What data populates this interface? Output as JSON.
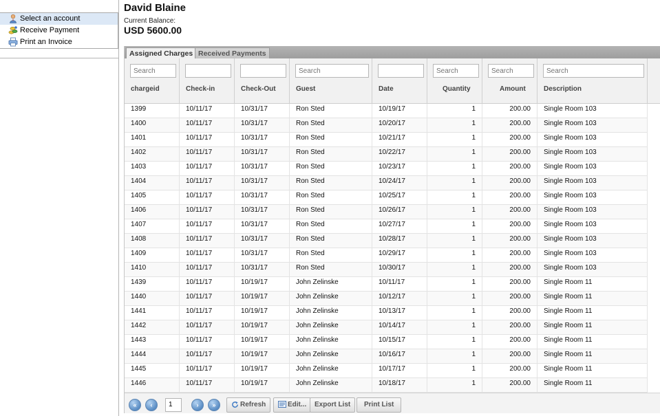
{
  "menu": {
    "items": [
      {
        "label": "Select an account",
        "icon": "person-icon",
        "selected": true
      },
      {
        "label": "Receive Payment",
        "icon": "coins-icon",
        "selected": false
      },
      {
        "label": "Print an Invoice",
        "icon": "printer-icon",
        "selected": false
      }
    ]
  },
  "account": {
    "name": "David Blaine",
    "balance_label": "Current Balance:",
    "balance_value": "USD 5600.00"
  },
  "tabs": [
    {
      "label": "Assigned Charges",
      "active": true
    },
    {
      "label": "Received Payments",
      "active": false
    }
  ],
  "columns": [
    {
      "label": "chargeid",
      "placeholder": "Search"
    },
    {
      "label": "Check-in",
      "placeholder": ""
    },
    {
      "label": "Check-Out",
      "placeholder": ""
    },
    {
      "label": "Guest",
      "placeholder": "Search"
    },
    {
      "label": "Date",
      "placeholder": ""
    },
    {
      "label": "Quantity",
      "placeholder": "Search"
    },
    {
      "label": "Amount",
      "placeholder": "Search"
    },
    {
      "label": "Description",
      "placeholder": "Search"
    }
  ],
  "rows": [
    [
      "1399",
      "10/11/17",
      "10/31/17",
      "Ron Sted",
      "10/19/17",
      "1",
      "200.00",
      "Single Room 103"
    ],
    [
      "1400",
      "10/11/17",
      "10/31/17",
      "Ron Sted",
      "10/20/17",
      "1",
      "200.00",
      "Single Room 103"
    ],
    [
      "1401",
      "10/11/17",
      "10/31/17",
      "Ron Sted",
      "10/21/17",
      "1",
      "200.00",
      "Single Room 103"
    ],
    [
      "1402",
      "10/11/17",
      "10/31/17",
      "Ron Sted",
      "10/22/17",
      "1",
      "200.00",
      "Single Room 103"
    ],
    [
      "1403",
      "10/11/17",
      "10/31/17",
      "Ron Sted",
      "10/23/17",
      "1",
      "200.00",
      "Single Room 103"
    ],
    [
      "1404",
      "10/11/17",
      "10/31/17",
      "Ron Sted",
      "10/24/17",
      "1",
      "200.00",
      "Single Room 103"
    ],
    [
      "1405",
      "10/11/17",
      "10/31/17",
      "Ron Sted",
      "10/25/17",
      "1",
      "200.00",
      "Single Room 103"
    ],
    [
      "1406",
      "10/11/17",
      "10/31/17",
      "Ron Sted",
      "10/26/17",
      "1",
      "200.00",
      "Single Room 103"
    ],
    [
      "1407",
      "10/11/17",
      "10/31/17",
      "Ron Sted",
      "10/27/17",
      "1",
      "200.00",
      "Single Room 103"
    ],
    [
      "1408",
      "10/11/17",
      "10/31/17",
      "Ron Sted",
      "10/28/17",
      "1",
      "200.00",
      "Single Room 103"
    ],
    [
      "1409",
      "10/11/17",
      "10/31/17",
      "Ron Sted",
      "10/29/17",
      "1",
      "200.00",
      "Single Room 103"
    ],
    [
      "1410",
      "10/11/17",
      "10/31/17",
      "Ron Sted",
      "10/30/17",
      "1",
      "200.00",
      "Single Room 103"
    ],
    [
      "1439",
      "10/11/17",
      "10/19/17",
      "John Zelinske",
      "10/11/17",
      "1",
      "200.00",
      "Single Room 11"
    ],
    [
      "1440",
      "10/11/17",
      "10/19/17",
      "John Zelinske",
      "10/12/17",
      "1",
      "200.00",
      "Single Room 11"
    ],
    [
      "1441",
      "10/11/17",
      "10/19/17",
      "John Zelinske",
      "10/13/17",
      "1",
      "200.00",
      "Single Room 11"
    ],
    [
      "1442",
      "10/11/17",
      "10/19/17",
      "John Zelinske",
      "10/14/17",
      "1",
      "200.00",
      "Single Room 11"
    ],
    [
      "1443",
      "10/11/17",
      "10/19/17",
      "John Zelinske",
      "10/15/17",
      "1",
      "200.00",
      "Single Room 11"
    ],
    [
      "1444",
      "10/11/17",
      "10/19/17",
      "John Zelinske",
      "10/16/17",
      "1",
      "200.00",
      "Single Room 11"
    ],
    [
      "1445",
      "10/11/17",
      "10/19/17",
      "John Zelinske",
      "10/17/17",
      "1",
      "200.00",
      "Single Room 11"
    ],
    [
      "1446",
      "10/11/17",
      "10/19/17",
      "John Zelinske",
      "10/18/17",
      "1",
      "200.00",
      "Single Room 11"
    ]
  ],
  "pager": {
    "page": "1",
    "refresh_label": "Refresh",
    "edit_label": "Edit...",
    "export_label": "Export List",
    "print_label": "Print List"
  },
  "colors": {
    "selected_menu_bg": "#dce8f6",
    "tab_bar": "#a8a8a8",
    "nav_button": "#5a8dc4"
  }
}
